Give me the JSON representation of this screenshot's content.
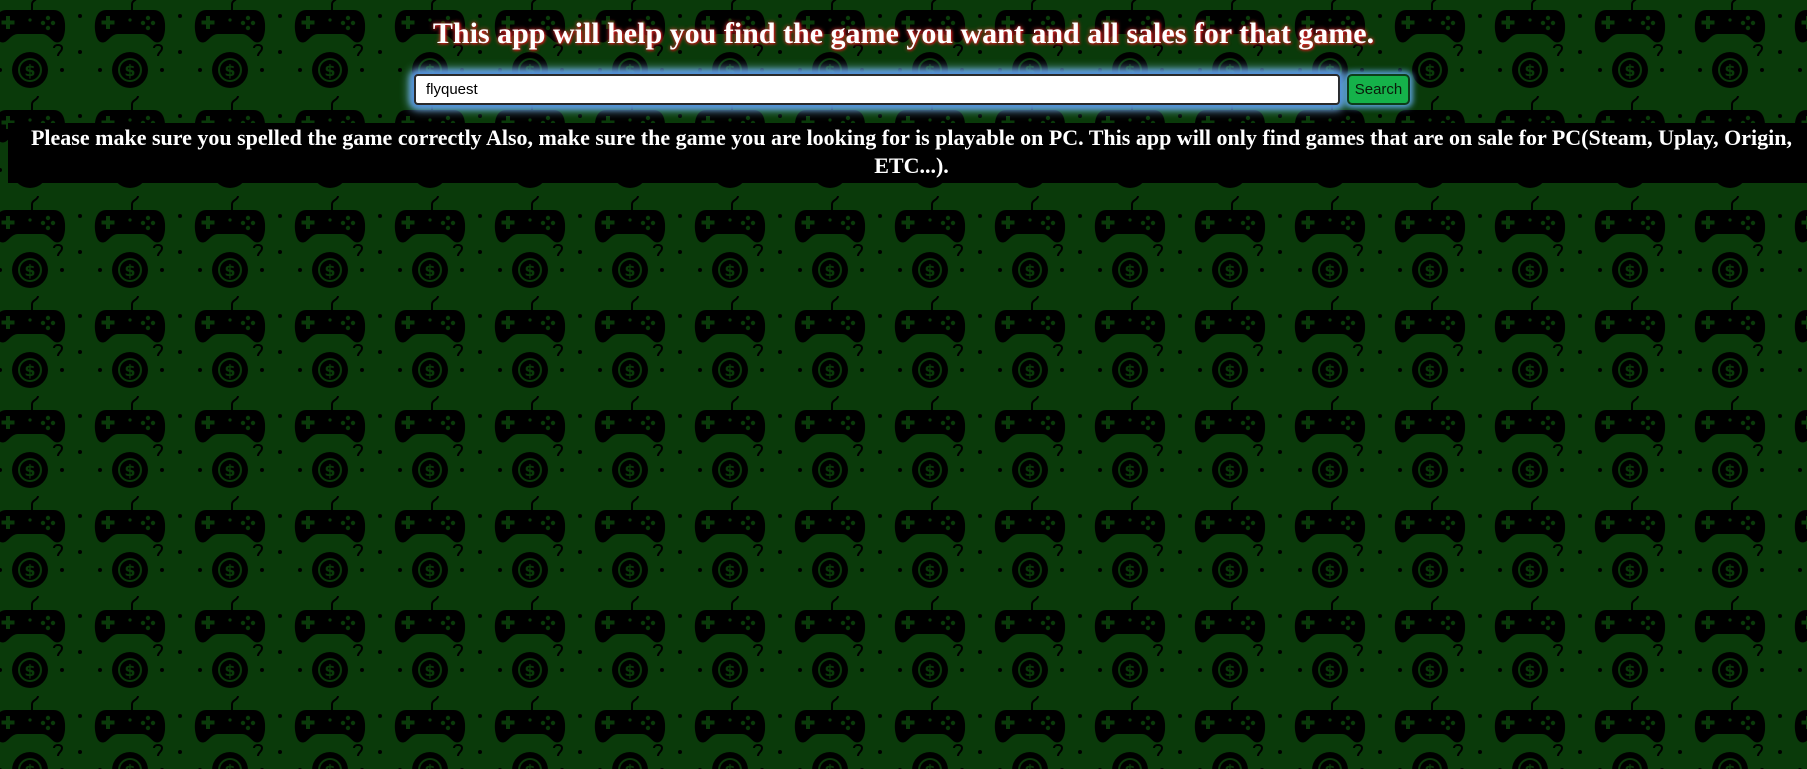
{
  "page": {
    "title": "This app will help you find the game you want and all sales for that game.",
    "background_pattern": "gamepad-and-dollar-coin-icon",
    "colors": {
      "background": "#0a3a0a",
      "pattern": "#000000",
      "button": "#15b24a",
      "notice_bar": "#000000",
      "text": "#ffffff"
    }
  },
  "search": {
    "value": "flyquest",
    "button_label": "Search"
  },
  "notice": {
    "text": "Please make sure you spelled the game correctly Also, make sure the game you are looking for is playable on PC. This app will only find games that are on sale for PC(Steam, Uplay, Origin, ETC...)."
  }
}
